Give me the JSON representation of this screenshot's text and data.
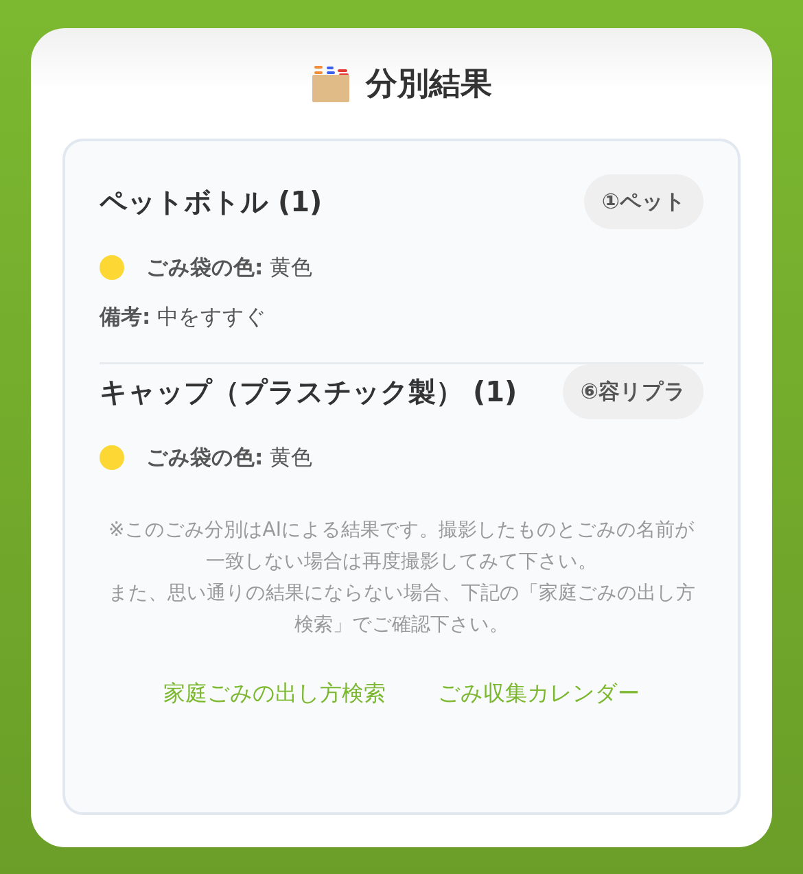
{
  "header": {
    "title": "分別結果"
  },
  "results": [
    {
      "name": "ペットボトル (1)",
      "badge": "①ペット",
      "bag": {
        "text": "**ごみ袋の色:** 黄色",
        "color": "#fdd835"
      },
      "note": "**備考:** 中をすすぐ"
    },
    {
      "name": "キャップ（プラスチック製） (1)",
      "badge": "⑥容リプラ",
      "bag": {
        "text": "**ごみ袋の色:** 黄色",
        "color": "#fdd835"
      }
    }
  ],
  "notice": [
    "※このごみ分別はAIによる結果です。撮影したものとごみの名前が一致しない場合は再度撮影してみて下さい。",
    "また、思い通りの結果にならない場合、下記の「家庭ごみの出し方検索」でご確認下さい。"
  ],
  "links": [
    "家庭ごみの出し方検索",
    "ごみ収集カレンダー"
  ]
}
